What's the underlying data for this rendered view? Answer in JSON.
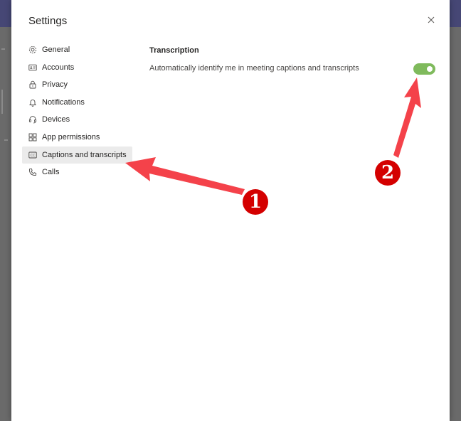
{
  "dialog": {
    "title": "Settings",
    "close_icon": "close-icon"
  },
  "nav": {
    "items": [
      {
        "label": "General",
        "icon": "gear-icon",
        "active": false
      },
      {
        "label": "Accounts",
        "icon": "id-card-icon",
        "active": false
      },
      {
        "label": "Privacy",
        "icon": "lock-icon",
        "active": false
      },
      {
        "label": "Notifications",
        "icon": "bell-icon",
        "active": false
      },
      {
        "label": "Devices",
        "icon": "headset-icon",
        "active": false
      },
      {
        "label": "App permissions",
        "icon": "grid-icon",
        "active": false
      },
      {
        "label": "Captions and transcripts",
        "icon": "cc-icon",
        "active": true
      },
      {
        "label": "Calls",
        "icon": "phone-icon",
        "active": false
      }
    ]
  },
  "content": {
    "section_title": "Transcription",
    "setting_label": "Automatically identify me in meeting captions and transcripts",
    "toggle_on": true
  },
  "annotations": {
    "badge_1": "1",
    "badge_2": "2",
    "arrow_color": "#f4424a"
  },
  "colors": {
    "toggle_on": "#7fba5c",
    "active_nav_bg": "#ebebeb",
    "badge_bg": "#d40000"
  }
}
